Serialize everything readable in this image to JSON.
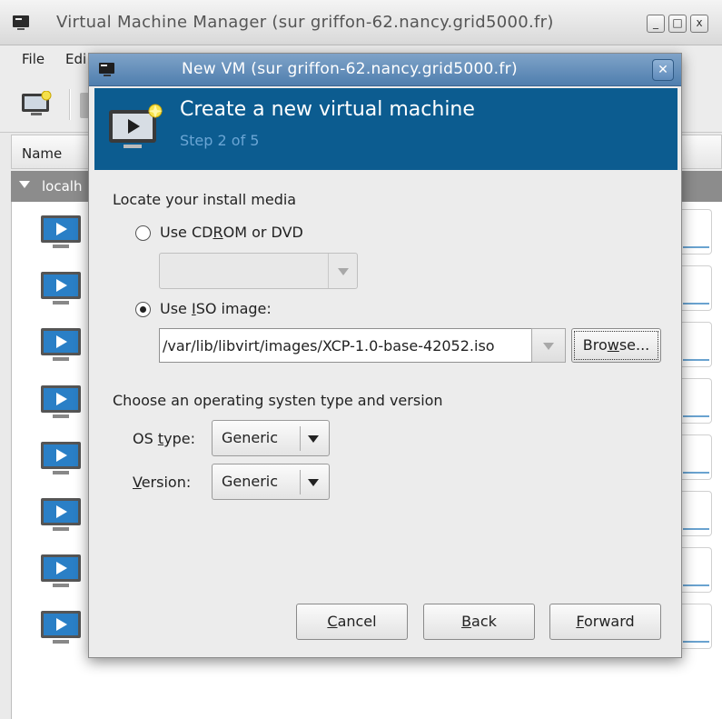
{
  "main_window": {
    "title": "Virtual Machine Manager (sur griffon-62.nancy.grid5000.fr)",
    "controls": {
      "minimize": "_",
      "maximize": "□",
      "close": "x"
    },
    "menu": {
      "file": "File",
      "edit": "Edi"
    },
    "list": {
      "column_name": "Name",
      "group_label": "localh"
    }
  },
  "dialog": {
    "title": "New VM (sur griffon-62.nancy.grid5000.fr)",
    "close_glyph": "✕",
    "banner": {
      "title": "Create a new virtual machine",
      "step": "Step 2 of 5"
    },
    "install_media": {
      "heading": "Locate your install media",
      "cdrom_label_pre": "Use CD",
      "cdrom_label_mn": "R",
      "cdrom_label_post": "OM or DVD",
      "cdrom_selected": false,
      "iso_label_pre": "Use ",
      "iso_label_mn": "I",
      "iso_label_post": "SO image:",
      "iso_selected": true,
      "iso_path": "/var/lib/libvirt/images/XCP-1.0-base-42052.iso",
      "browse_pre": "Bro",
      "browse_mn": "w",
      "browse_post": "se..."
    },
    "os": {
      "heading": "Choose an operating systen type and version",
      "type_label_pre": "OS ",
      "type_label_mn": "t",
      "type_label_post": "ype:",
      "type_value": "Generic",
      "version_label_mn": "V",
      "version_label_post": "ersion:",
      "version_value": "Generic"
    },
    "buttons": {
      "cancel_mn": "C",
      "cancel_post": "ancel",
      "back_mn": "B",
      "back_post": "ack",
      "forward_mn": "F",
      "forward_post": "orward"
    }
  },
  "colors": {
    "banner_bg": "#0c5c90",
    "banner_step": "#6aa5d4",
    "titlebar_active": "#5f8bbb",
    "group_row": "#8c8c8c"
  }
}
